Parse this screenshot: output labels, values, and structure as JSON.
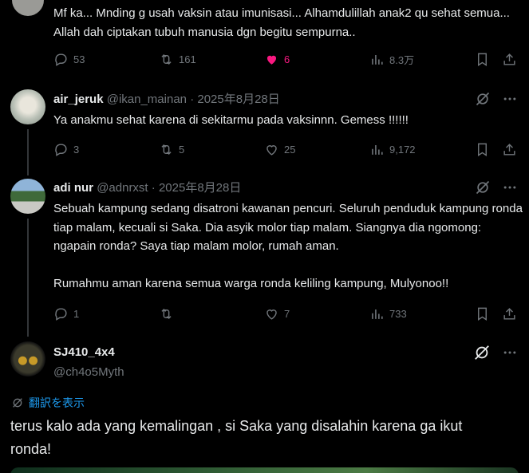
{
  "posts": [
    {
      "text": "Mf ka... Mnding g usah vaksin atau imunisasi... Alhamdulillah anak2 qu sehat semua... Allah dah ciptakan tubuh manusia dgn begitu sempurna..",
      "replies": "53",
      "reposts": "161",
      "likes": "6",
      "views": "8.3万"
    },
    {
      "name": "air_jeruk",
      "handle": "@ikan_mainan",
      "sep": "·",
      "date": "2025年8月28日",
      "text": "Ya anakmu sehat karena di sekitarmu pada vaksinnn. Gemess !!!!!!",
      "replies": "3",
      "reposts": "5",
      "likes": "25",
      "views": "9,172"
    },
    {
      "name": "adi nur",
      "handle": "@adnrxst",
      "sep": "·",
      "date": "2025年8月28日",
      "text": "Sebuah kampung sedang disatroni kawanan pencuri. Seluruh penduduk kampung ronda tiap malam, kecuali si Saka. Dia asyik molor tiap malam. Siangnya dia ngomong: ngapain ronda? Saya tiap malam molor, rumah aman.\n\nRumahmu aman karena semua warga ronda keliling kampung, Mulyonoo!!",
      "replies": "1",
      "reposts": "",
      "likes": "7",
      "views": "733"
    }
  ],
  "main_post": {
    "name": "SJ410_4x4",
    "handle": "@ch4o5Myth",
    "translate_label": "翻訳を表示",
    "text": "terus kalo ada yang kemalingan , si Saka yang disalahin karena ga ikut ronda!"
  },
  "colors": {
    "like_active": "#f91880",
    "muted": "#71767b",
    "link": "#1d9bf0"
  }
}
